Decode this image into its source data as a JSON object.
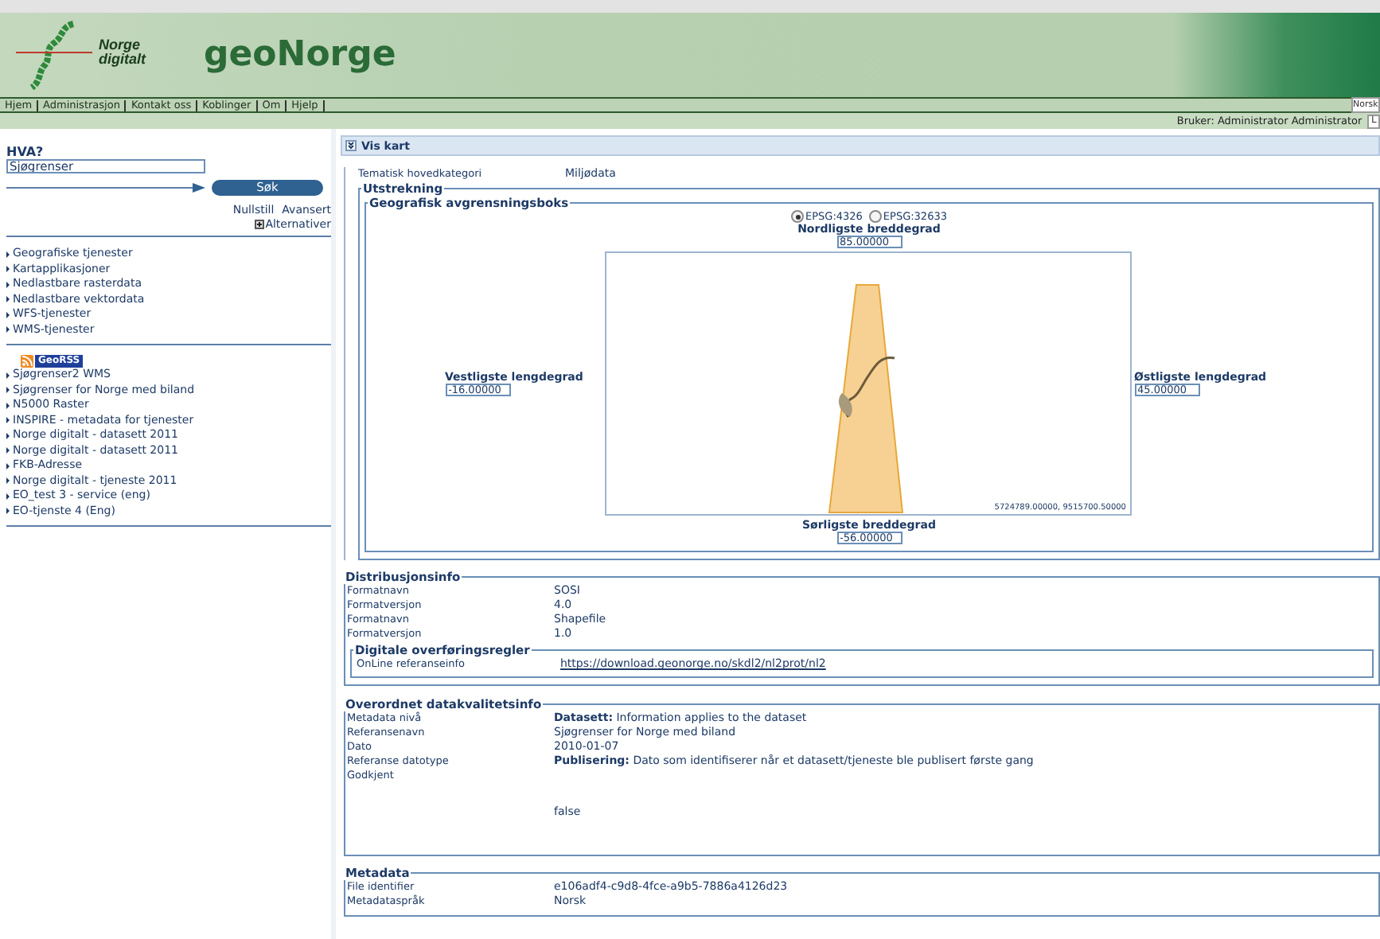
{
  "header": {
    "logo_text": "Norge digitalt",
    "site_title": "geoNorge"
  },
  "nav": [
    "Hjem",
    "Administrasjon",
    "Kontakt oss",
    "Koblinger",
    "Om",
    "Hjelp"
  ],
  "language_select": {
    "value": "Norsk"
  },
  "corner_button": "L",
  "user": "Bruker: Administrator Administrator",
  "sidebar": {
    "search_label": "HVA?",
    "search_value": "Sjøgrenser",
    "search_button": "Søk",
    "links": [
      "Nullstill",
      "Avansert"
    ],
    "options_toggle": {
      "label": "Alternativer",
      "expanded": false
    },
    "categories": [
      "Geografiske tjenester",
      "Kartapplikasjoner",
      "Nedlastbare rasterdata",
      "Nedlastbare vektordata",
      "WFS-tjenester",
      "WMS-tjenester"
    ],
    "feed_badge": "GeoRSS",
    "recent": [
      "Sjøgrenser2 WMS",
      "Sjøgrenser for Norge med biland",
      "N5000 Raster",
      "INSPIRE - metadata for tjenester",
      "Norge digitalt - datasett 2011",
      "Norge digitalt - datasett 2011",
      "FKB-Adresse",
      "Norge digitalt - tjeneste 2011",
      "EO_test 3 - service (eng)",
      "EO-tjenste 4 (Eng)"
    ]
  },
  "panel": {
    "title": "Vis kart",
    "expanded": true
  },
  "topic": {
    "label": "Tematisk hovedkategori",
    "value": "Miljødata"
  },
  "extent": {
    "title": "Utstrekning",
    "box_title": "Geografisk avgrensningsboks",
    "projections": [
      {
        "label": "EPSG:4326",
        "selected": true
      },
      {
        "label": "EPSG:32633",
        "selected": false
      }
    ],
    "north": {
      "label": "Nordligste breddegrad",
      "value": "85.00000"
    },
    "west": {
      "label": "Vestligste lengdegrad",
      "value": "-16.00000"
    },
    "east": {
      "label": "Østligste lengdegrad",
      "value": "45.00000"
    },
    "south": {
      "label": "Sørligste breddegrad",
      "value": "-56.00000"
    },
    "map_coordinates": "5724789.00000, 9515700.50000"
  },
  "distribution": {
    "title": "Distribusjonsinfo",
    "rows": [
      {
        "label": "Formatnavn",
        "value": "SOSI"
      },
      {
        "label": "Formatversjon",
        "value": "4.0"
      },
      {
        "label": "Formatnavn",
        "value": "Shapefile"
      },
      {
        "label": "Formatversjon",
        "value": "1.0"
      }
    ],
    "transfer": {
      "title": "Digitale overføringsregler",
      "label": "OnLine referanseinfo",
      "link": "https://download.geonorge.no/skdl2/nl2prot/nl2"
    }
  },
  "quality": {
    "title": "Overordnet datakvalitetsinfo",
    "rows": [
      {
        "label": "Metadata nivå",
        "value": "**Datasett:** Information applies to the dataset"
      },
      {
        "label": "Referansenavn",
        "value": "Sjøgrenser for Norge med biland"
      },
      {
        "label": "Dato",
        "value": "2010-01-07"
      },
      {
        "label": "Referanse datotype",
        "value": "**Publisering:** Dato som identifiserer når et datasett/tjeneste ble publisert første gang"
      }
    ],
    "approved": {
      "label": "Godkjent",
      "value": "false"
    }
  },
  "metadata": {
    "title": "Metadata",
    "rows": [
      {
        "label": "File identifier",
        "value": "e106adf4-c9d8-4fce-a9b5-7886a4126d23"
      },
      {
        "label": "Metadataspråk",
        "value": "Norsk"
      }
    ]
  }
}
